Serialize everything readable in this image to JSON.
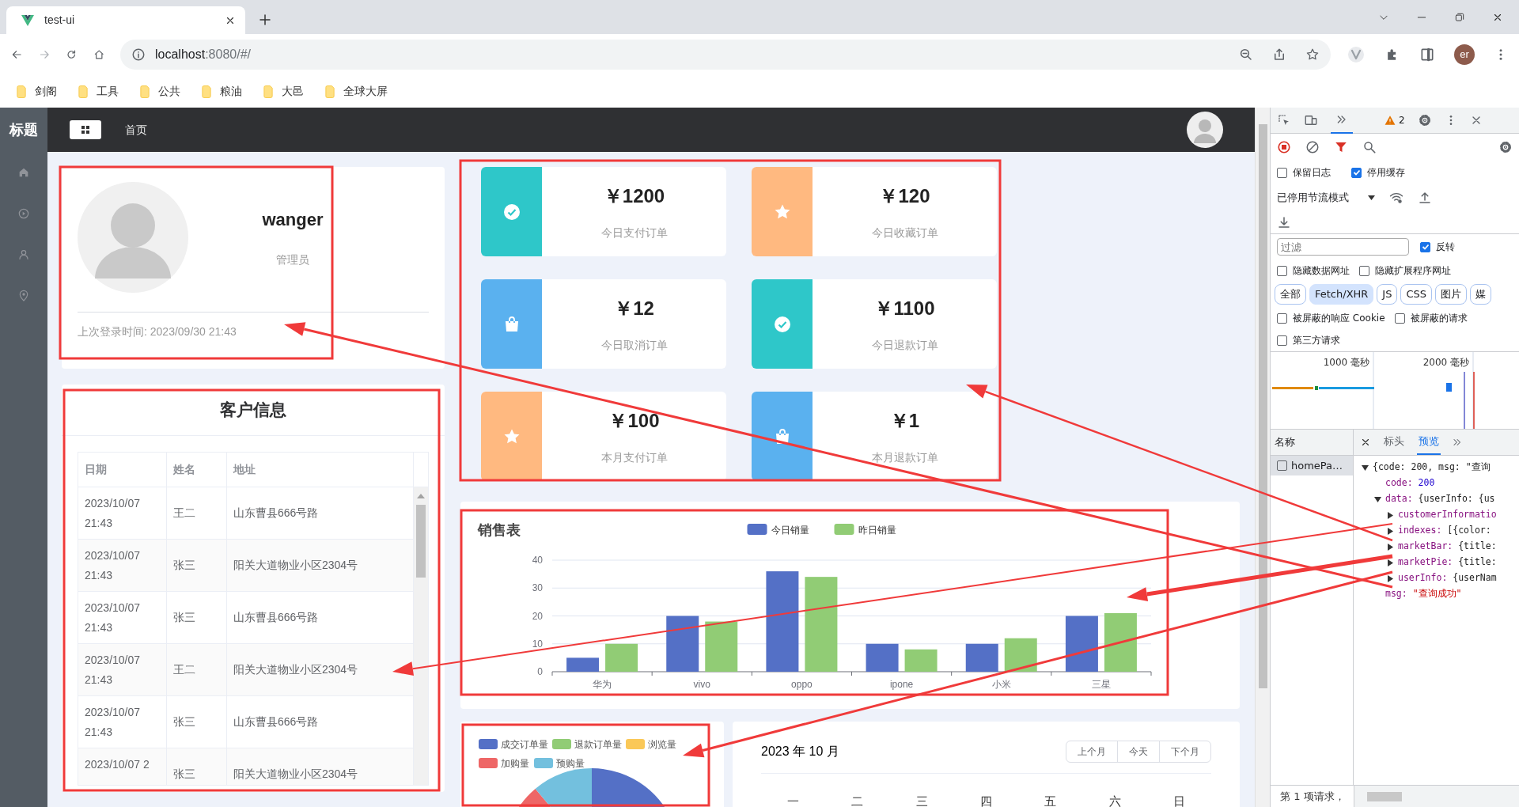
{
  "browser": {
    "tab_title": "test-ui",
    "url_host": "localhost",
    "url_rest": ":8080/#/",
    "profile": "er",
    "bookmarks": [
      "剑阁",
      "工具",
      "公共",
      "粮油",
      "大邑",
      "全球大屏"
    ]
  },
  "app": {
    "logo": "标题",
    "nav": [
      {
        "kind": "home"
      },
      {
        "kind": "play"
      },
      {
        "kind": "user"
      },
      {
        "kind": "location"
      }
    ],
    "breadcrumb": "首页"
  },
  "user_card": {
    "name": "wanger",
    "role": "管理员",
    "last_login": "上次登录时间: 2023/09/30 21:43"
  },
  "customers": {
    "title": "客户信息",
    "columns": [
      "日期",
      "姓名",
      "地址"
    ],
    "rows": [
      {
        "date": "2023/10/07 21:43",
        "name": "王二",
        "address": "山东曹县666号路"
      },
      {
        "date": "2023/10/07 21:43",
        "name": "张三",
        "address": "阳关大道物业小区2304号"
      },
      {
        "date": "2023/10/07 21:43",
        "name": "张三",
        "address": "山东曹县666号路"
      },
      {
        "date": "2023/10/07 21:43",
        "name": "王二",
        "address": "阳关大道物业小区2304号"
      },
      {
        "date": "2023/10/07 21:43",
        "name": "张三",
        "address": "山东曹县666号路"
      },
      {
        "date": "2023/10/07 2",
        "name": "张三",
        "address": "阳关大道物业小区2304号"
      }
    ]
  },
  "stats": [
    {
      "amount": "￥1200",
      "label": "今日支付订单",
      "kind": "check",
      "color": "#2ec7c9"
    },
    {
      "amount": "￥120",
      "label": "今日收藏订单",
      "kind": "star",
      "color": "#ffb980"
    },
    {
      "amount": "￥12",
      "label": "今日取消订单",
      "kind": "bag",
      "color": "#5ab1ef"
    },
    {
      "amount": "￥1100",
      "label": "今日退款订单",
      "kind": "check",
      "color": "#2ec7c9"
    },
    {
      "amount": "￥100",
      "label": "本月支付订单",
      "kind": "star",
      "color": "#ffb980"
    },
    {
      "amount": "￥1",
      "label": "本月退款订单",
      "kind": "bag",
      "color": "#5ab1ef"
    }
  ],
  "sales_chart": {
    "chart_data": {
      "type": "bar",
      "title": "销售表",
      "categories": [
        "华为",
        "vivo",
        "oppo",
        "ipone",
        "小米",
        "三星"
      ],
      "series": [
        {
          "name": "今日销量",
          "color": "#5470c6",
          "values": [
            5,
            20,
            36,
            10,
            10,
            20
          ]
        },
        {
          "name": "昨日销量",
          "color": "#91cc75",
          "values": [
            10,
            18,
            34,
            8,
            12,
            21
          ]
        }
      ],
      "ylim": [
        0,
        40
      ],
      "yticks": [
        0,
        10,
        20,
        30,
        40
      ],
      "grid": true,
      "legend": true
    }
  },
  "pie_card": {
    "legend": [
      {
        "label": "成交订单量",
        "color": "#5470c6"
      },
      {
        "label": "退款订单量",
        "color": "#91cc75"
      },
      {
        "label": "浏览量",
        "color": "#fac858"
      },
      {
        "label": "加购量",
        "color": "#ee6666"
      },
      {
        "label": "预购量",
        "color": "#73c0de"
      }
    ]
  },
  "calendar": {
    "title": "2023 年 10 月",
    "buttons": [
      "上个月",
      "今天",
      "下个月"
    ],
    "weekdays": [
      "一",
      "二",
      "三",
      "四",
      "五",
      "六",
      "日"
    ]
  },
  "devtools": {
    "warning_count": "2",
    "options": [
      {
        "label": "保留日志",
        "checked": false
      },
      {
        "label": "停用缓存",
        "checked": true
      }
    ],
    "throttle": "已停用节流模式",
    "filter": {
      "placeholder": "过滤"
    },
    "invert": {
      "label": "反转",
      "checked": true
    },
    "hide_options": [
      {
        "label": "隐藏数据网址",
        "checked": false
      },
      {
        "label": "隐藏扩展程序网址",
        "checked": false
      }
    ],
    "types": [
      {
        "label": "全部",
        "selected": false
      },
      {
        "label": "Fetch/XHR",
        "selected": true
      },
      {
        "label": "JS",
        "selected": false
      },
      {
        "label": "CSS",
        "selected": false
      },
      {
        "label": "图片",
        "selected": false
      },
      {
        "label": "媒",
        "selected": false
      }
    ],
    "blocked_options": [
      {
        "label": "被屏蔽的响应 Cookie",
        "checked": false
      },
      {
        "label": "被屏蔽的请求",
        "checked": false
      }
    ],
    "third_party": {
      "label": "第三方请求",
      "checked": false
    },
    "timeline_labels": [
      "1000 毫秒",
      "2000 毫秒"
    ],
    "name_header": "名称",
    "requests": [
      {
        "name": "homePa…",
        "selected": true
      }
    ],
    "detail_tabs": [
      {
        "label": "标头",
        "selected": false
      },
      {
        "label": "预览",
        "selected": true
      }
    ],
    "preview": [
      {
        "value": "{code: 200, msg: \"查询",
        "kind": "object",
        "expanded": true,
        "children": [
          {
            "key": "code:",
            "value": "200",
            "kind": "number"
          },
          {
            "key": "data:",
            "value": "{userInfo: {us",
            "kind": "object",
            "expanded": true,
            "children": [
              {
                "key": "customerInformatio",
                "expanded": false
              },
              {
                "key": "indexes:",
                "value": "[{color:",
                "kind": "object",
                "expanded": false
              },
              {
                "key": "marketBar:",
                "value": "{title:",
                "kind": "object",
                "expanded": false
              },
              {
                "key": "marketPie:",
                "value": "{title:",
                "kind": "object",
                "expanded": false
              },
              {
                "key": "userInfo:",
                "value": "{userNam",
                "kind": "object",
                "expanded": false
              }
            ]
          },
          {
            "key": "msg:",
            "value": "\"查询成功\"",
            "kind": "string"
          }
        ]
      }
    ],
    "status": "第 1 项请求，"
  }
}
